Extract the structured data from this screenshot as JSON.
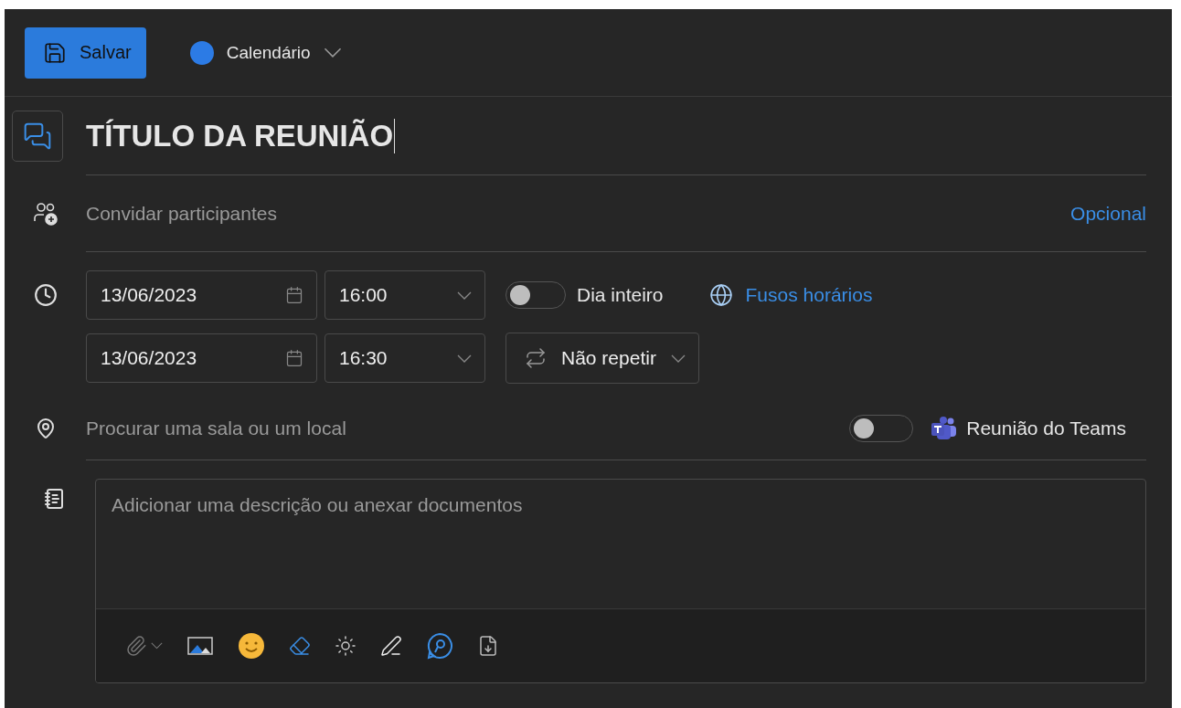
{
  "toolbar": {
    "save_button": "Salvar",
    "calendar": "Calendário"
  },
  "title": {
    "value": "TÍTULO DA REUNIÃO"
  },
  "attendees": {
    "placeholder": "Convidar participantes",
    "optional_link": "Opcional"
  },
  "start": {
    "date": "13/06/2023",
    "time": "16:00"
  },
  "end": {
    "date": "13/06/2023",
    "time": "16:30"
  },
  "all_day": {
    "label": "Dia inteiro",
    "on": false
  },
  "time_zones_link": "Fusos horários",
  "repeat": "Não repetir",
  "location": {
    "placeholder": "Procurar uma sala ou um local"
  },
  "teams_meeting": {
    "label": "Reunião do Teams",
    "on": false
  },
  "description": {
    "placeholder": "Adicionar uma descrição ou anexar documentos"
  }
}
